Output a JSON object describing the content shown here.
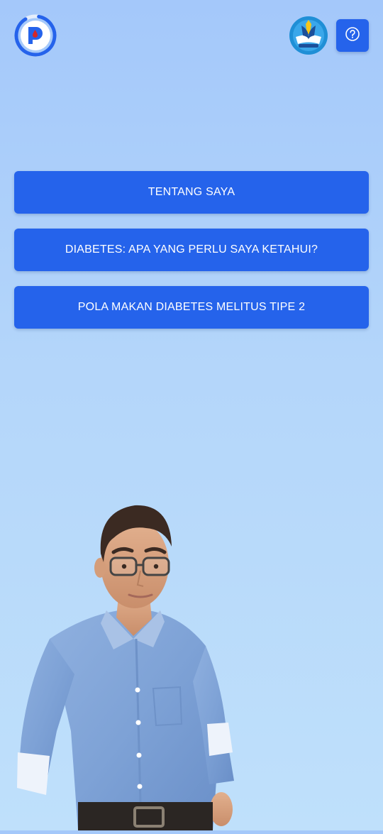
{
  "header": {
    "app_logo_icon": "app-logo-p-blood-drop-icon",
    "emblem_icon": "tut-wuri-handayani-emblem-icon",
    "help_icon": "question-mark-icon"
  },
  "menu": {
    "items": [
      {
        "label": "TENTANG SAYA"
      },
      {
        "label": "DIABETES: APA YANG PERLU SAYA KETAHUI?"
      },
      {
        "label": "POLA MAKAN DIABETES MELITUS TIPE 2"
      }
    ]
  },
  "avatar": {
    "icon": "3d-avatar-man-glasses-blue-shirt"
  },
  "colors": {
    "accent": "#2563eb",
    "background_top": "#a4c8fa",
    "background_bottom": "#bfe0fb",
    "button_text": "#ffffff",
    "blood_drop": "#d62828"
  }
}
